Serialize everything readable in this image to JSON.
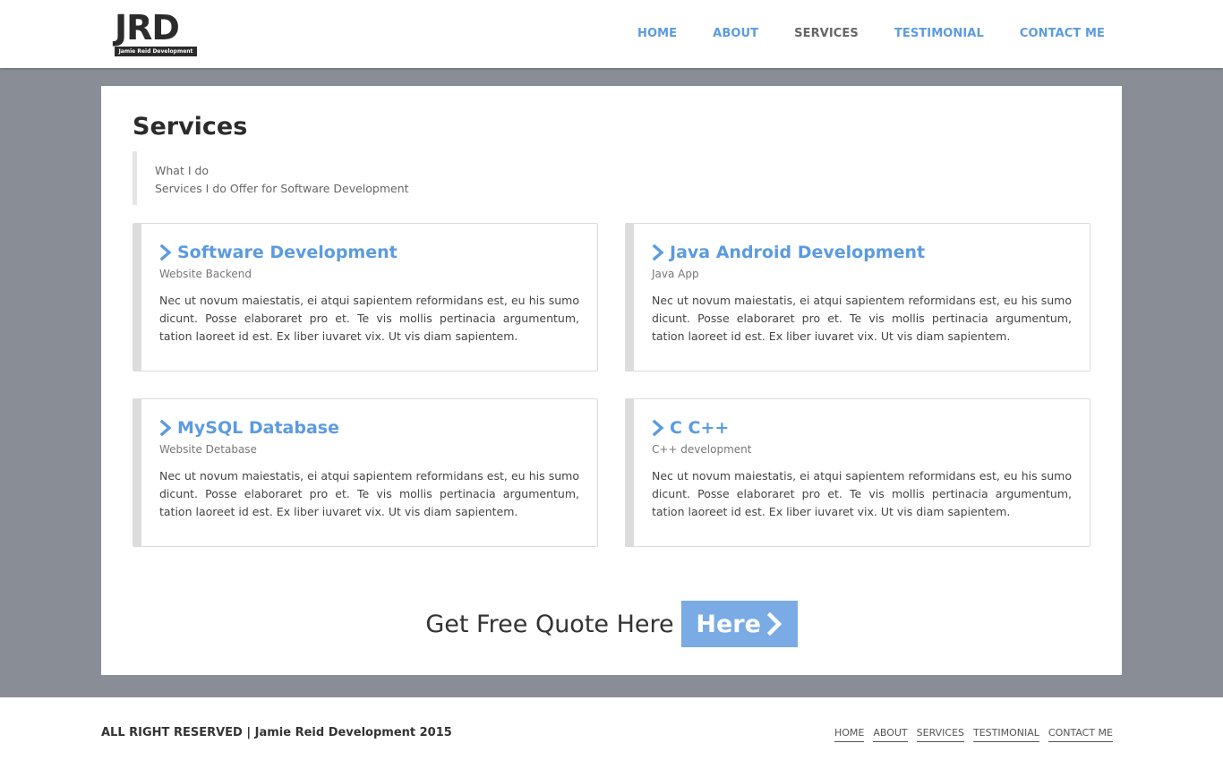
{
  "header": {
    "logo": {
      "letters": "JRD",
      "tagline": "Jamie Reid Development"
    },
    "nav": [
      {
        "label": "HOME",
        "active": false
      },
      {
        "label": "ABOUT",
        "active": false
      },
      {
        "label": "SERVICES",
        "active": true
      },
      {
        "label": "TESTIMONIAL",
        "active": false
      },
      {
        "label": "CONTACT ME",
        "active": false
      }
    ]
  },
  "main": {
    "title": "Services",
    "intro": {
      "line1": "What I do",
      "line2": "Services I do Offer for Software Development"
    },
    "services": [
      {
        "title": "Software Development",
        "subtitle": "Website Backend",
        "body": "Nec ut novum maiestatis, ei atqui sapientem reformidans est, eu his sumo dicunt. Posse elaboraret pro et. Te vis mollis pertinacia argumentum, tation laoreet id est. Ex liber iuvaret vix. Ut vis diam sapientem."
      },
      {
        "title": "Java Android Development",
        "subtitle": "Java App",
        "body": "Nec ut novum maiestatis, ei atqui sapientem reformidans est, eu his sumo dicunt. Posse elaboraret pro et. Te vis mollis pertinacia argumentum, tation laoreet id est. Ex liber iuvaret vix. Ut vis diam sapientem."
      },
      {
        "title": "MySQL Database",
        "subtitle": "Website Detabase",
        "body": "Nec ut novum maiestatis, ei atqui sapientem reformidans est, eu his sumo dicunt. Posse elaboraret pro et. Te vis mollis pertinacia argumentum, tation laoreet id est. Ex liber iuvaret vix. Ut vis diam sapientem."
      },
      {
        "title": "C C++",
        "subtitle": "C++ development",
        "body": "Nec ut novum maiestatis, ei atqui sapientem reformidans est, eu his sumo dicunt. Posse elaboraret pro et. Te vis mollis pertinacia argumentum, tation laoreet id est. Ex liber iuvaret vix. Ut vis diam sapientem."
      }
    ],
    "quote": {
      "text": "Get Free Quote Here",
      "button_label": "Here",
      "button_icon": "chevron-right-icon"
    }
  },
  "footer": {
    "copyright": "ALL RIGHT RESERVED | Jamie Reid Development 2015",
    "nav": [
      "HOME",
      "ABOUT",
      "SERVICES",
      "TESTIMONIAL",
      "CONTACT ME"
    ]
  },
  "colors": {
    "accent": "#5b9be0",
    "button": "#7aabe5",
    "page_background": "#898e96",
    "card_border": "#dcdcdc"
  }
}
